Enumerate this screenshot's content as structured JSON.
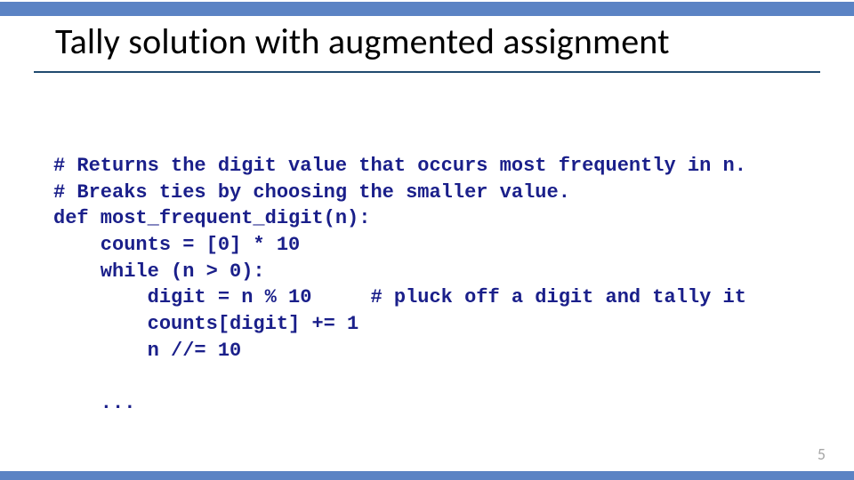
{
  "slide": {
    "title": "Tally solution with augmented assignment",
    "page_number": "5"
  },
  "code": {
    "lines": [
      "# Returns the digit value that occurs most frequently in n.",
      "# Breaks ties by choosing the smaller value.",
      "def most_frequent_digit(n):",
      "    counts = [0] * 10",
      "    while (n > 0):",
      "        digit = n % 10     # pluck off a digit and tally it",
      "        counts[digit] += 1",
      "        n //= 10",
      "",
      "    ..."
    ]
  }
}
